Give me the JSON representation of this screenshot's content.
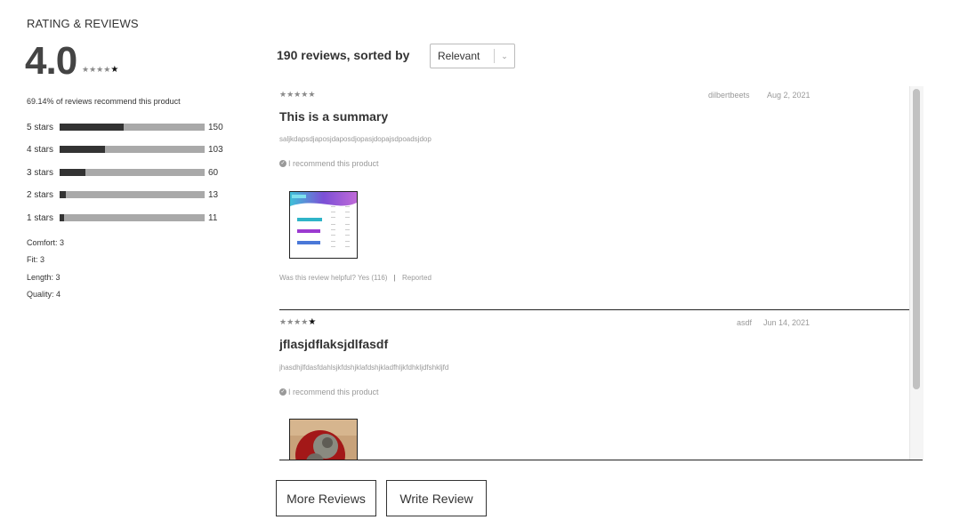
{
  "summary": {
    "heading": "RATING & REVIEWS",
    "average": "4.0",
    "average_stars": 4,
    "recommend_text": "69.14% of reviews recommend this product",
    "breakdown": [
      {
        "label": "5 stars",
        "count": "150",
        "fraction": 0.44
      },
      {
        "label": "4 stars",
        "count": "103",
        "fraction": 0.31
      },
      {
        "label": "3 stars",
        "count": "60",
        "fraction": 0.18
      },
      {
        "label": "2 stars",
        "count": "13",
        "fraction": 0.04
      },
      {
        "label": "1 stars",
        "count": "11",
        "fraction": 0.03
      }
    ],
    "characteristics": [
      {
        "text": "Comfort: 3"
      },
      {
        "text": "Fit: 3"
      },
      {
        "text": "Length: 3"
      },
      {
        "text": "Quality: 4"
      }
    ]
  },
  "list": {
    "count_label": "190 reviews, sorted by",
    "sort": {
      "selected": "Relevant",
      "icon": "chevron-down-icon"
    }
  },
  "reviews": [
    {
      "stars": 5,
      "user": "dilbertbeets",
      "date": "Aug 2, 2021",
      "title": "This is a summary",
      "body": "saljkdapsdjaposjdaposdjopasjdopajsdpoadsjdop",
      "recommend": "I recommend this product",
      "helpful_prefix": "Was this review helpful?",
      "helpful_yes": "Yes",
      "helpful_count": "(116)",
      "report": "Reported"
    },
    {
      "stars": 4,
      "user": "asdf",
      "date": "Jun 14, 2021",
      "title": "jflasjdflaksjdlfasdf",
      "body": "jhasdhjlfdasfdahlsjkfdshjklafdshjkladfhljkfdhkljdfshkljfd",
      "recommend": "I recommend this product"
    }
  ],
  "actions": {
    "more_reviews": "More Reviews",
    "write_review": "Write Review"
  },
  "colors": {
    "bar_fill": "#333333",
    "bar_track": "#a9a9a9",
    "muted": "#999999"
  }
}
